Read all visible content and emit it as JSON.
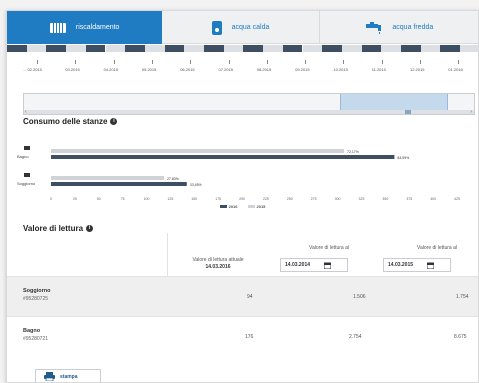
{
  "tabs": [
    {
      "label": "riscaldamento",
      "icon": "radiator-icon",
      "active": true
    },
    {
      "label": "acqua calda",
      "icon": "water-heater-icon",
      "active": false
    },
    {
      "label": "acqua fredda",
      "icon": "water-tap-icon",
      "active": false
    }
  ],
  "timeline": {
    "labels": [
      "... 02.2015",
      "03.2015",
      "04.2015",
      "05.2015",
      "06.2015",
      "07.2015",
      "08.2015",
      "09.2015",
      "10.2015",
      "11.2015",
      "12.2015",
      "01.2016"
    ]
  },
  "slider": {
    "left_arrow": "‹",
    "right_arrow": "›",
    "grip": "≡"
  },
  "consumption": {
    "title": "Consumo delle stanze",
    "info_icon": "info-icon",
    "rooms": [
      {
        "name": "Bagno",
        "icon": "bathtub-icon",
        "values": [
          84.59,
          72.17
        ],
        "labels": [
          "84,59%",
          "72,17%"
        ]
      },
      {
        "name": "Soggiorno",
        "icon": "sofa-icon",
        "values": [
          33.45,
          27.83
        ],
        "labels": [
          "33,45%",
          "27,83%"
        ]
      }
    ],
    "legend": [
      "2016",
      "2015"
    ],
    "colors": {
      "2016": "#3f4f63",
      "2015": "#cfd3d8"
    }
  },
  "chart_data": {
    "type": "bar",
    "orientation": "horizontal",
    "title": "Consumo delle stanze",
    "categories": [
      "Bagno",
      "Soggiorno"
    ],
    "series": [
      {
        "name": "2016",
        "values": [
          84.59,
          33.45
        ]
      },
      {
        "name": "2015",
        "values": [
          72.17,
          27.83
        ]
      }
    ],
    "x_ticks": [
      "0",
      "25",
      "50",
      "75",
      "100",
      "125",
      "150",
      "175",
      "200",
      "225",
      "250",
      "275",
      "300",
      "325",
      "350",
      "375",
      "400",
      "425"
    ],
    "xlim": [
      0,
      100
    ],
    "grid": false,
    "legend": "bottom"
  },
  "readings": {
    "title": "Valore di lettura",
    "col_current_label": "Valore di lettura attuale",
    "col_current_date": "14.03.2016",
    "col_a_label": "Valore di lettura al",
    "col_a_date": "14.03.2014",
    "col_b_label": "Valore di lettura al",
    "col_b_date": "14.03.2015",
    "rows": [
      {
        "name": "Soggiorno",
        "code": "#95280725",
        "current": "94",
        "a": "1.506",
        "b": "1.754"
      },
      {
        "name": "Bagno",
        "code": "#95280721",
        "current": "176",
        "a": "2.754",
        "b": "8.675"
      }
    ]
  },
  "print_label": "stampa"
}
